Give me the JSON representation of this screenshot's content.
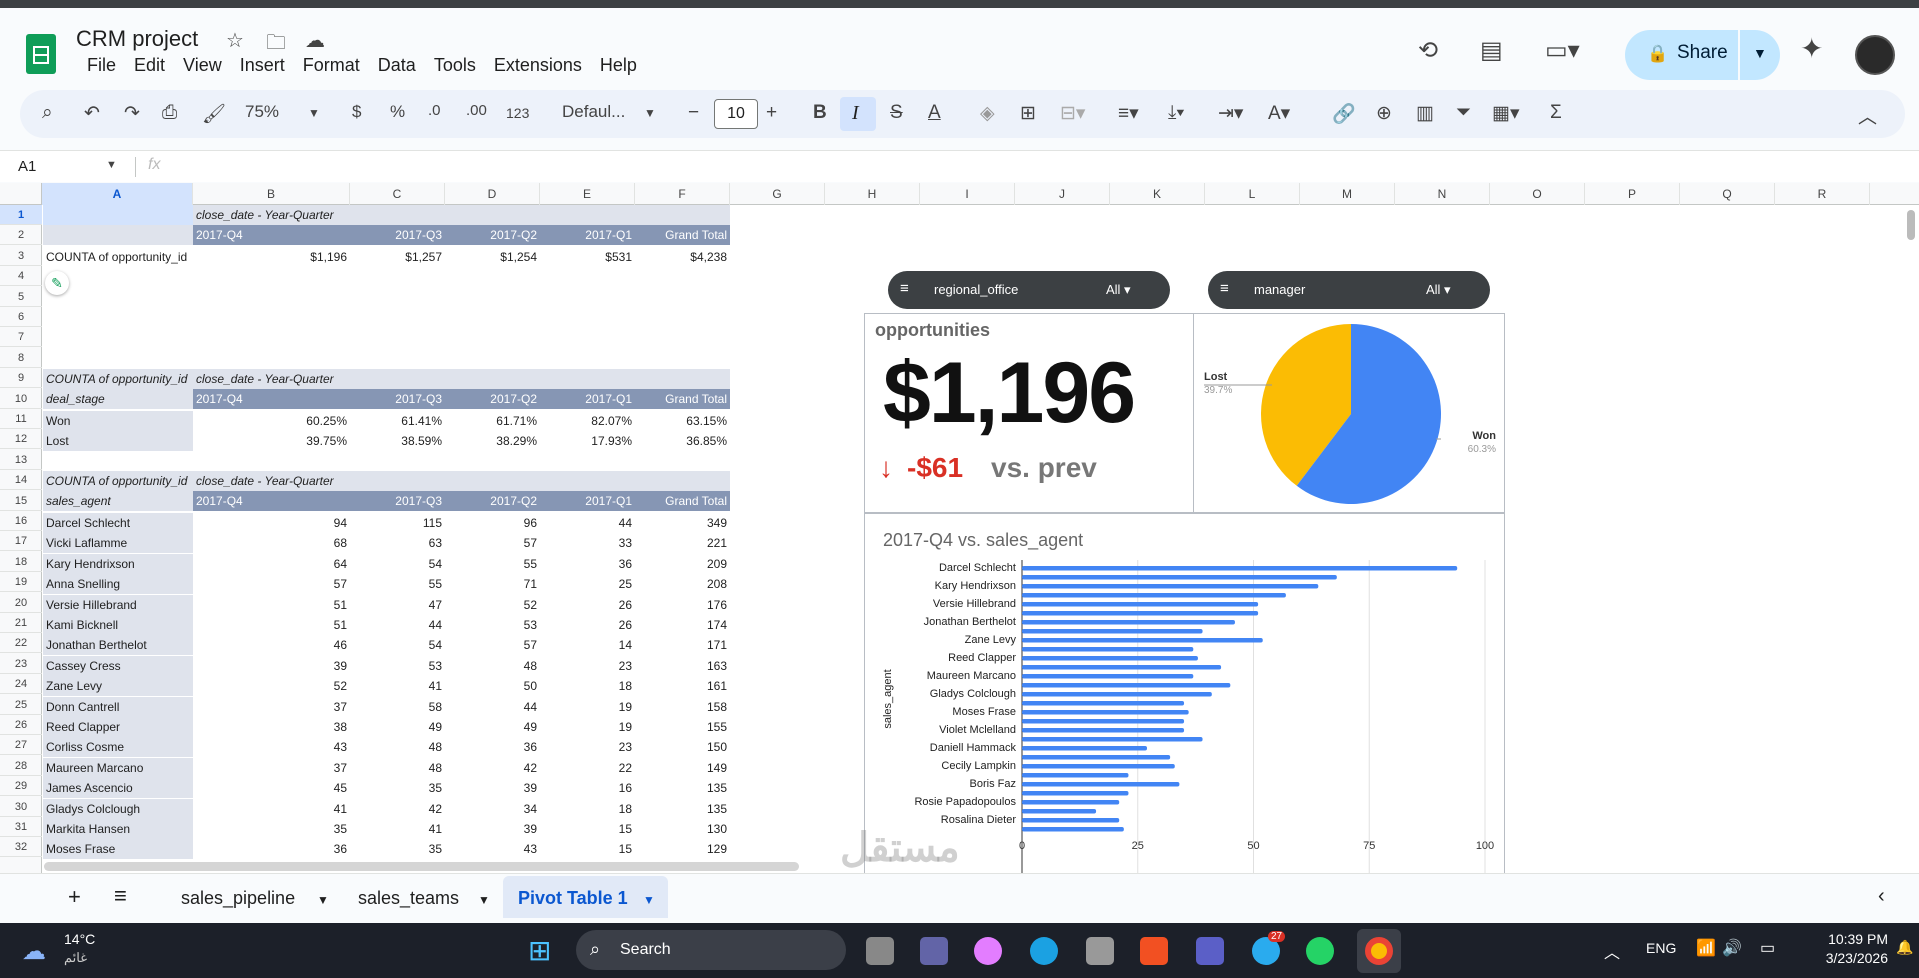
{
  "doc": {
    "title": "CRM project",
    "menus": [
      "File",
      "Edit",
      "View",
      "Insert",
      "Format",
      "Data",
      "Tools",
      "Extensions",
      "Help"
    ],
    "share": "Share"
  },
  "toolbar": {
    "zoom": "75%",
    "currency": "$",
    "percent": "%",
    "dec_less": ".0",
    "dec_more": ".00",
    "num_format": "123",
    "font": "Defaul...",
    "font_size": "10",
    "minus": "−",
    "plus": "+"
  },
  "formula": {
    "cell_ref": "A1",
    "fx": "fx"
  },
  "columns": [
    "A",
    "B",
    "C",
    "D",
    "E",
    "F",
    "G",
    "H",
    "I",
    "J",
    "K",
    "L",
    "M",
    "N",
    "O",
    "P",
    "Q",
    "R"
  ],
  "rows": [
    "1",
    "2",
    "3",
    "4",
    "5",
    "6",
    "7",
    "8",
    "9",
    "10",
    "11",
    "12",
    "13",
    "14",
    "15",
    "16",
    "17",
    "18",
    "19",
    "20",
    "21",
    "22",
    "23",
    "24",
    "25",
    "26",
    "27",
    "28",
    "29",
    "30",
    "31",
    "32"
  ],
  "pivot1": {
    "col_label": "close_date - Year-Quarter",
    "headers": [
      "2017-Q4",
      "2017-Q3",
      "2017-Q2",
      "2017-Q1",
      "Grand Total"
    ],
    "row_label": "COUNTA of opportunity_id",
    "values": [
      "$1,196",
      "$1,257",
      "$1,254",
      "$531",
      "$4,238"
    ]
  },
  "pivot2": {
    "title": "COUNTA of opportunity_id",
    "col_label": "close_date - Year-Quarter",
    "row_field": "deal_stage",
    "headers": [
      "2017-Q4",
      "2017-Q3",
      "2017-Q2",
      "2017-Q1",
      "Grand Total"
    ],
    "rows": [
      [
        "Won",
        "60.25%",
        "61.41%",
        "61.71%",
        "82.07%",
        "63.15%"
      ],
      [
        "Lost",
        "39.75%",
        "38.59%",
        "38.29%",
        "17.93%",
        "36.85%"
      ]
    ]
  },
  "pivot3": {
    "title": "COUNTA of opportunity_id",
    "col_label": "close_date - Year-Quarter",
    "row_field": "sales_agent",
    "headers": [
      "2017-Q4",
      "2017-Q3",
      "2017-Q2",
      "2017-Q1",
      "Grand Total"
    ],
    "rows": [
      [
        "Darcel Schlecht",
        "94",
        "115",
        "96",
        "44",
        "349"
      ],
      [
        "Vicki Laflamme",
        "68",
        "63",
        "57",
        "33",
        "221"
      ],
      [
        "Kary Hendrixson",
        "64",
        "54",
        "55",
        "36",
        "209"
      ],
      [
        "Anna Snelling",
        "57",
        "55",
        "71",
        "25",
        "208"
      ],
      [
        "Versie Hillebrand",
        "51",
        "47",
        "52",
        "26",
        "176"
      ],
      [
        "Kami Bicknell",
        "51",
        "44",
        "53",
        "26",
        "174"
      ],
      [
        "Jonathan Berthelot",
        "46",
        "54",
        "57",
        "14",
        "171"
      ],
      [
        "Cassey Cress",
        "39",
        "53",
        "48",
        "23",
        "163"
      ],
      [
        "Zane Levy",
        "52",
        "41",
        "50",
        "18",
        "161"
      ],
      [
        "Donn Cantrell",
        "37",
        "58",
        "44",
        "19",
        "158"
      ],
      [
        "Reed Clapper",
        "38",
        "49",
        "49",
        "19",
        "155"
      ],
      [
        "Corliss Cosme",
        "43",
        "48",
        "36",
        "23",
        "150"
      ],
      [
        "Maureen Marcano",
        "37",
        "48",
        "42",
        "22",
        "149"
      ],
      [
        "James Ascencio",
        "45",
        "35",
        "39",
        "16",
        "135"
      ],
      [
        "Gladys Colclough",
        "41",
        "42",
        "34",
        "18",
        "135"
      ],
      [
        "Markita Hansen",
        "35",
        "41",
        "39",
        "15",
        "130"
      ],
      [
        "Moses Frase",
        "36",
        "35",
        "43",
        "15",
        "129"
      ]
    ]
  },
  "filters": [
    {
      "name": "regional_office",
      "value": "All ▾"
    },
    {
      "name": "manager",
      "value": "All ▾"
    }
  ],
  "scorecard": {
    "title": "opportunities",
    "value": "$1,196",
    "delta": "-$61",
    "compare": "vs. prev"
  },
  "chart_data": [
    {
      "type": "pie",
      "labels": [
        "Lost",
        "Won"
      ],
      "values": [
        39.7,
        60.3
      ],
      "pct_labels": [
        "39.7%",
        "60.3%"
      ],
      "colors": [
        "#fbbc04",
        "#4285f4"
      ]
    },
    {
      "type": "bar",
      "title": "2017-Q4 vs. sales_agent",
      "ylabel": "sales_agent",
      "xlim": [
        0,
        100
      ],
      "ticks": [
        "0",
        "25",
        "50",
        "75",
        "100"
      ],
      "categories": [
        "Darcel Schlecht",
        "",
        "Kary Hendrixson",
        "",
        "Versie Hillebrand",
        "",
        "Jonathan Berthelot",
        "",
        "Zane Levy",
        "",
        "Reed Clapper",
        "",
        "Maureen Marcano",
        "",
        "Gladys Colclough",
        "",
        "Moses Frase",
        "",
        "Violet Mclelland",
        "",
        "Daniell Hammack",
        "",
        "Cecily Lampkin",
        "",
        "Boris Faz",
        "",
        "Rosie Papadopoulos",
        "",
        "Rosalina Dieter",
        ""
      ],
      "values": [
        94,
        68,
        64,
        57,
        51,
        51,
        46,
        39,
        52,
        37,
        38,
        43,
        37,
        45,
        41,
        35,
        36,
        35,
        35,
        39,
        27,
        32,
        33,
        23,
        34,
        23,
        21,
        16,
        21,
        22
      ],
      "color": "#4285f4"
    }
  ],
  "sheets": [
    "sales_pipeline",
    "sales_teams",
    "Pivot Table 1"
  ],
  "taskbar": {
    "temp": "14°C",
    "weather": "غائم",
    "search": "Search",
    "lang": "ENG",
    "time": "10:39 PM",
    "date": "3/23/2026",
    "badge": "27"
  },
  "watermark": "مستقل"
}
